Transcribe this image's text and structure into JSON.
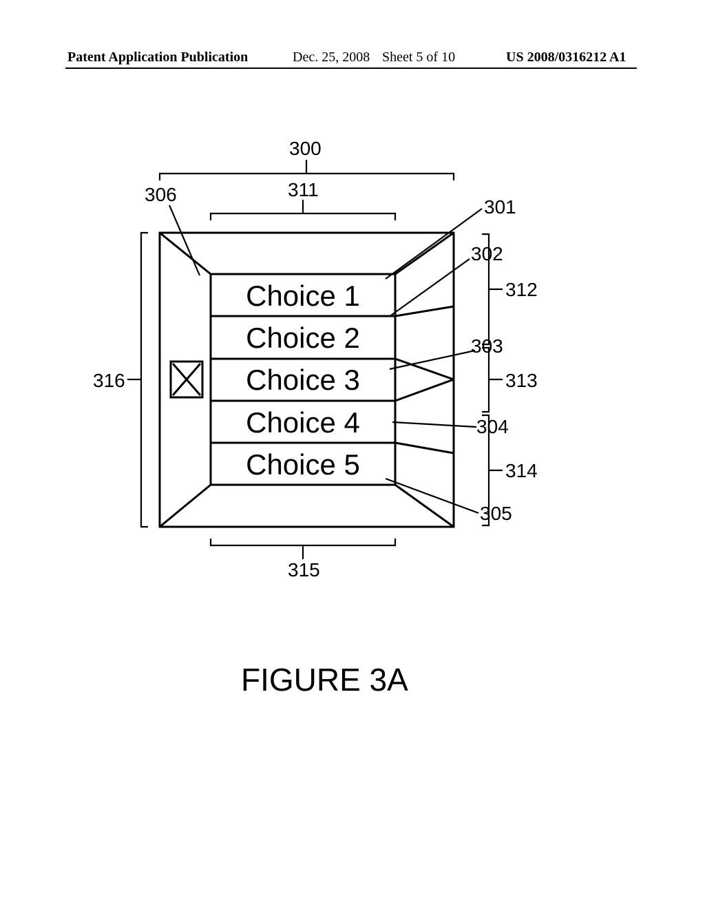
{
  "header": {
    "left": "Patent Application Publication",
    "date": "Dec. 25, 2008",
    "sheet": "Sheet 5 of 10",
    "pubno": "US 2008/0316212 A1"
  },
  "labels": {
    "n300": "300",
    "n311": "311",
    "n306": "306",
    "n301": "301",
    "n302": "302",
    "n312": "312",
    "n303": "303",
    "n313": "313",
    "n316": "316",
    "n304": "304",
    "n314": "314",
    "n305": "305",
    "n315": "315"
  },
  "choices": {
    "c1": "Choice 1",
    "c2": "Choice 2",
    "c3": "Choice 3",
    "c4": "Choice 4",
    "c5": "Choice 5"
  },
  "marker": "X",
  "figure_caption": "FIGURE 3A"
}
